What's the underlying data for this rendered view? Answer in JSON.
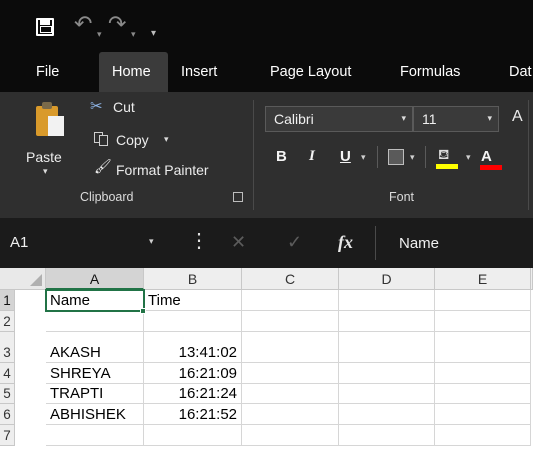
{
  "quick_access": {
    "icons": [
      "save-icon",
      "undo-icon",
      "redo-icon",
      "customize-qat-icon"
    ]
  },
  "tabs": [
    "File",
    "Home",
    "Insert",
    "Page Layout",
    "Formulas",
    "Dat"
  ],
  "active_tab": "Home",
  "ribbon": {
    "clipboard": {
      "paste_label": "Paste",
      "cut_label": "Cut",
      "copy_label": "Copy",
      "format_painter_label": "Format Painter",
      "group_label": "Clipboard"
    },
    "font": {
      "font_name": "Calibri",
      "font_size": "11",
      "bold": "B",
      "italic": "I",
      "underline": "U",
      "grow_font": "A",
      "font_color_glyph": "A",
      "group_label": "Font",
      "highlight_color": "#ffff00",
      "font_color": "#ff0000"
    }
  },
  "formula_bar": {
    "name_box": "A1",
    "fx_label": "fx",
    "formula": "Name"
  },
  "grid": {
    "columns": [
      "A",
      "B",
      "C",
      "D",
      "E"
    ],
    "rows": [
      {
        "num": "1",
        "a": "Name",
        "b": "Time"
      },
      {
        "num": "2",
        "a": "",
        "b": ""
      },
      {
        "num": "3",
        "a": "AKASH",
        "b": "13:41:02"
      },
      {
        "num": "4",
        "a": "SHREYA",
        "b": "16:21:09"
      },
      {
        "num": "5",
        "a": "TRAPTI",
        "b": "16:21:24"
      },
      {
        "num": "6",
        "a": "ABHISHEK",
        "b": "16:21:52"
      },
      {
        "num": "7",
        "a": "",
        "b": ""
      }
    ],
    "active_cell": "A1",
    "accent_color": "#217346"
  }
}
